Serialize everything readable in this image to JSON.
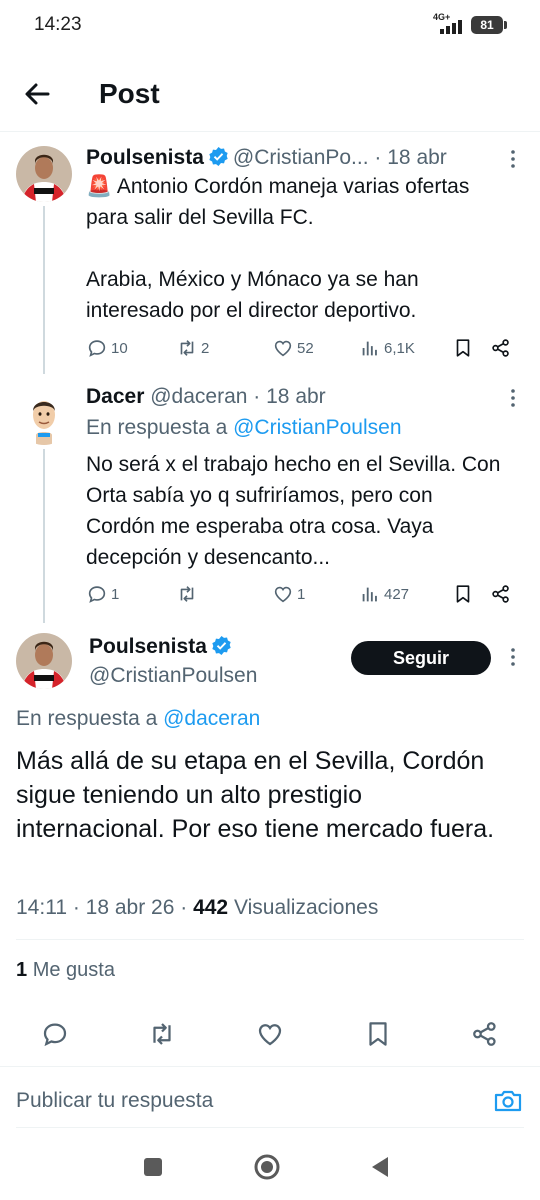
{
  "status_bar": {
    "time": "14:23",
    "network": "4G+",
    "battery": "81"
  },
  "header": {
    "title": "Post"
  },
  "tweets": [
    {
      "name": "Poulsenista",
      "handle": "@CristianPo...",
      "date": "· 18 abr",
      "text": "🚨 Antonio Cordón maneja varias ofertas para salir del Sevilla FC.\n\nArabia, México y Mónaco ya se han interesado por el director deportivo.",
      "replies": "10",
      "retweets": "2",
      "likes": "52",
      "views": "6,1K"
    },
    {
      "name": "Dacer",
      "handle": "@daceran",
      "date": "· 18 abr",
      "reply_prefix": "En respuesta a",
      "reply_to": "@CristianPoulsen",
      "text": "No será x el trabajo hecho en el Sevilla. Con Orta sabía yo q sufriríamos, pero con Cordón me esperaba otra cosa. Vaya decepción y desencanto...",
      "replies": "1",
      "retweets": "",
      "likes": "1",
      "views": "427"
    }
  ],
  "main_tweet": {
    "name": "Poulsenista",
    "handle": "@CristianPoulsen",
    "follow_label": "Seguir",
    "reply_prefix": "En respuesta a",
    "reply_to": "@daceran",
    "text": "Más allá de su etapa en el Sevilla, Cordón sigue teniendo un alto prestigio internacional. Por eso tiene mercado fuera.",
    "time": "14:11 · 18 abr 26 ·",
    "views_count": "442",
    "views_label": "Visualizaciones",
    "likes_count": "1",
    "likes_label": "Me gusta"
  },
  "reply_bar": {
    "placeholder": "Publicar tu respuesta"
  },
  "colors": {
    "accent": "#1d9bf0",
    "text": "#0f1419",
    "muted": "#536471",
    "button_bg": "#0f1419",
    "sevilla_red": "#d5232a"
  },
  "icons": [
    "back-arrow-icon",
    "verified-badge-icon",
    "more-icon",
    "reply-icon",
    "retweet-icon",
    "like-icon",
    "views-icon",
    "bookmark-icon",
    "share-icon",
    "camera-icon",
    "square-nav-icon",
    "circle-nav-icon",
    "triangle-nav-icon"
  ]
}
